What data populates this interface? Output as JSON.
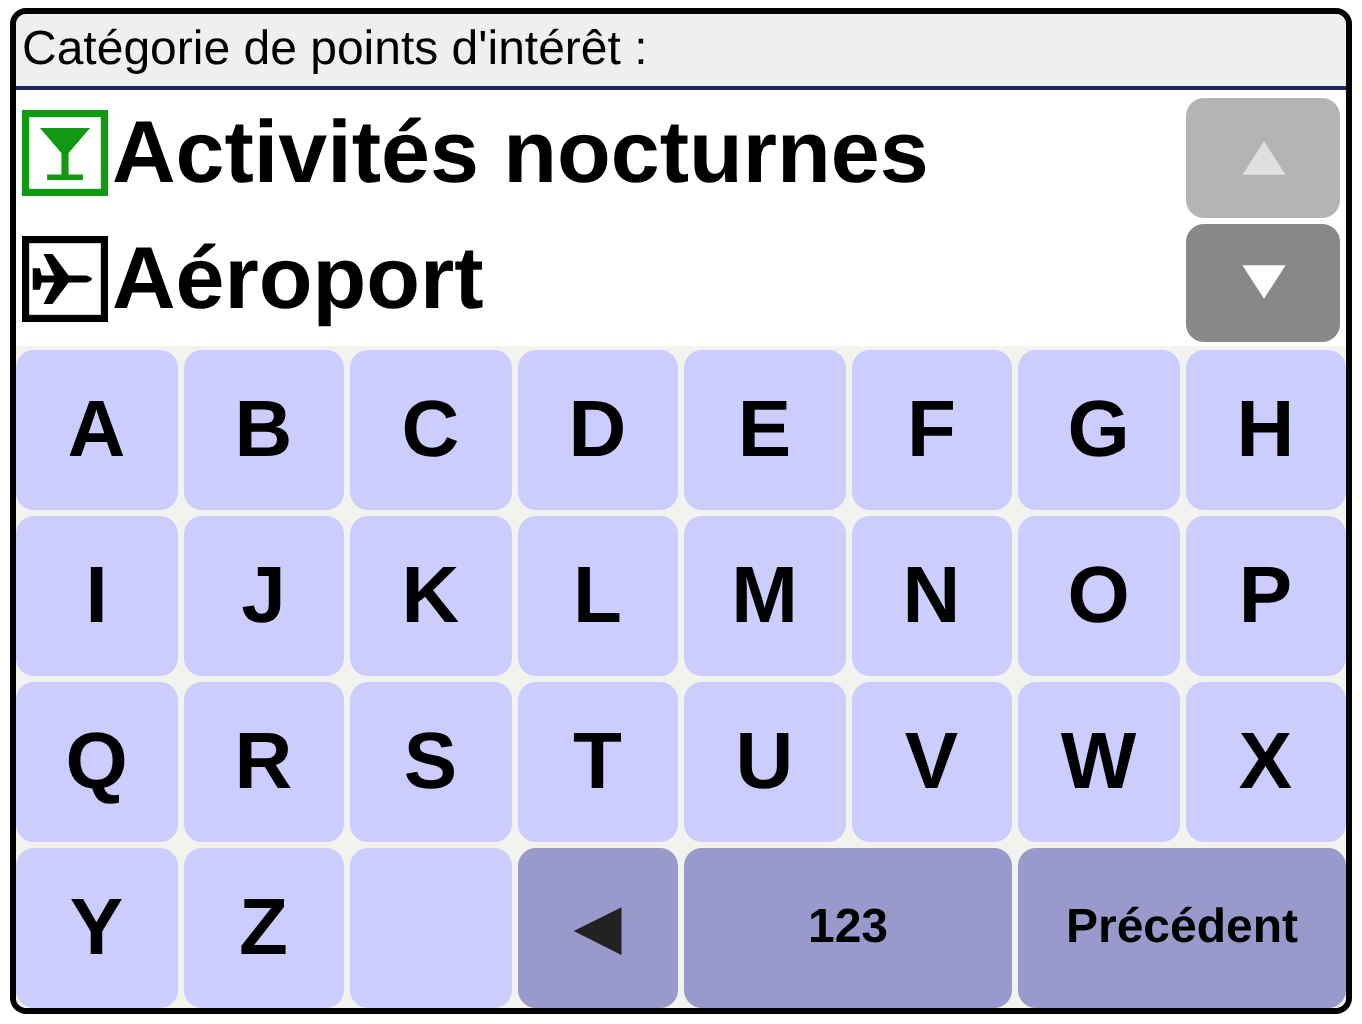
{
  "header": {
    "title": "Catégorie de points d'intérêt :"
  },
  "list": {
    "items": [
      {
        "label": "Activités nocturnes",
        "kind": "glass"
      },
      {
        "label": "Aéroport",
        "kind": "plane"
      }
    ],
    "scroll_up": {
      "disabled": true
    },
    "scroll_down": {
      "disabled": false
    }
  },
  "keyboard": {
    "keys": [
      {
        "label": "A",
        "kind": "letter"
      },
      {
        "label": "B",
        "kind": "letter"
      },
      {
        "label": "C",
        "kind": "letter"
      },
      {
        "label": "D",
        "kind": "letter"
      },
      {
        "label": "E",
        "kind": "letter"
      },
      {
        "label": "F",
        "kind": "letter"
      },
      {
        "label": "G",
        "kind": "letter"
      },
      {
        "label": "H",
        "kind": "letter"
      },
      {
        "label": "I",
        "kind": "letter"
      },
      {
        "label": "J",
        "kind": "letter"
      },
      {
        "label": "K",
        "kind": "letter"
      },
      {
        "label": "L",
        "kind": "letter"
      },
      {
        "label": "M",
        "kind": "letter"
      },
      {
        "label": "N",
        "kind": "letter"
      },
      {
        "label": "O",
        "kind": "letter"
      },
      {
        "label": "P",
        "kind": "letter"
      },
      {
        "label": "Q",
        "kind": "letter"
      },
      {
        "label": "R",
        "kind": "letter"
      },
      {
        "label": "S",
        "kind": "letter"
      },
      {
        "label": "T",
        "kind": "letter"
      },
      {
        "label": "U",
        "kind": "letter"
      },
      {
        "label": "V",
        "kind": "letter"
      },
      {
        "label": "W",
        "kind": "letter"
      },
      {
        "label": "X",
        "kind": "letter"
      },
      {
        "label": "Y",
        "kind": "letter"
      },
      {
        "label": "Z",
        "kind": "letter"
      },
      {
        "kind": "blank"
      },
      {
        "label": "◄",
        "kind": "backspace"
      },
      {
        "label": "123",
        "kind": "wide"
      },
      {
        "label": "Précédent",
        "kind": "wide"
      }
    ]
  }
}
